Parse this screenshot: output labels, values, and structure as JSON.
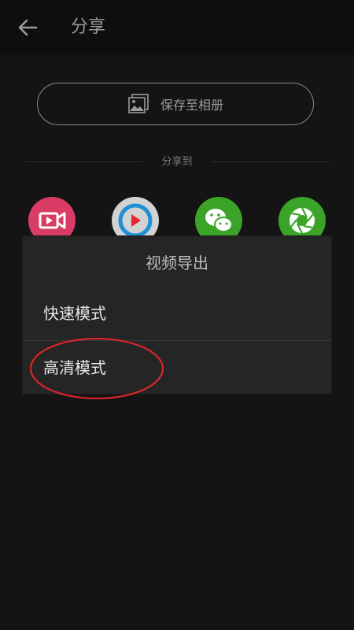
{
  "header": {
    "title": "分享",
    "back_icon": "arrow-left-icon"
  },
  "save_album": {
    "label": "保存至相册",
    "icon": "photo-album-icon"
  },
  "share_to": {
    "label": "分享到"
  },
  "share_targets": [
    {
      "icon": "video-camera-icon",
      "color": "#e0416a"
    },
    {
      "icon": "youku-play-icon",
      "color": "#d8d8d8"
    },
    {
      "icon": "wechat-icon",
      "color": "#3fae29"
    },
    {
      "icon": "moments-shutter-icon",
      "color": "#3fae29"
    }
  ],
  "dialog": {
    "title": "视频导出",
    "options": [
      {
        "label": "快速模式"
      },
      {
        "label": "高清模式"
      }
    ]
  },
  "annotation": {
    "color": "#e0282a"
  }
}
